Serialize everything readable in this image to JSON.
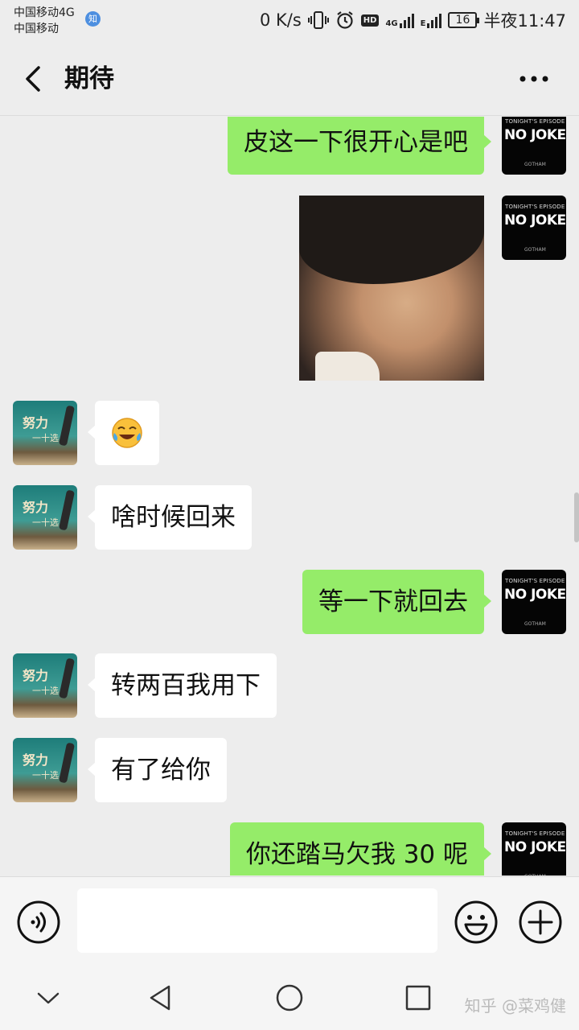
{
  "status_bar": {
    "carrier_1": "中国移动4G",
    "carrier_2": "中国移动",
    "app_badge": "知",
    "net_speed": "0 K/s",
    "hd_label": "HD",
    "net_4g": "4G",
    "net_e": "E",
    "battery": "16",
    "time": "半夜11:47"
  },
  "header": {
    "title": "期待"
  },
  "me_avatar": {
    "line1": "TONIGHT'S EPISODE IS",
    "line2": "NO JOKE",
    "line3": "GOTHAM"
  },
  "them_avatar": {
    "line1": "努力",
    "line2": "一十选"
  },
  "messages": [
    {
      "from": "me",
      "type": "text",
      "text": "皮这一下很开心是吧"
    },
    {
      "from": "me",
      "type": "sticker"
    },
    {
      "from": "them",
      "type": "emoji",
      "emoji": "face-with-tears-of-joy-icon"
    },
    {
      "from": "them",
      "type": "text",
      "text": "啥时候回来"
    },
    {
      "from": "me",
      "type": "text",
      "text": "等一下就回去"
    },
    {
      "from": "them",
      "type": "text",
      "text": "转两百我用下"
    },
    {
      "from": "them",
      "type": "text",
      "text": "有了给你"
    },
    {
      "from": "me",
      "type": "text",
      "text": "你还踏马欠我 30 呢"
    }
  ],
  "input": {
    "value": ""
  },
  "watermark": "知乎 @菜鸡健",
  "colors": {
    "my_bubble": "#95ec69",
    "their_bubble": "#ffffff",
    "background": "#ededed"
  }
}
